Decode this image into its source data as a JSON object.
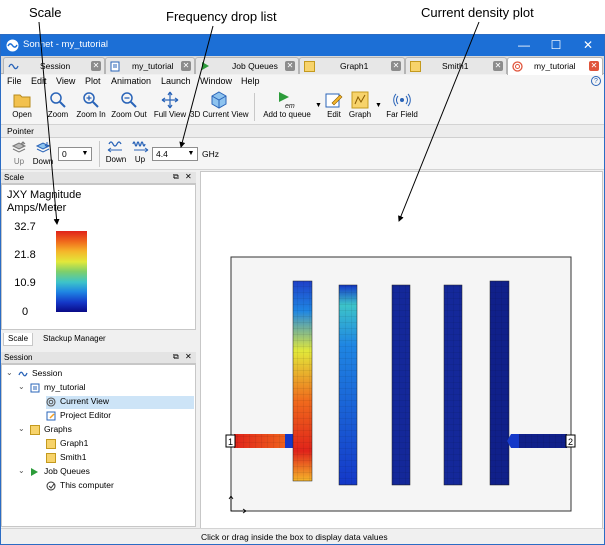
{
  "annotations": {
    "scale": "Scale",
    "frequency": "Frequency drop list",
    "current": "Current density plot"
  },
  "window": {
    "title": "Sonnet - my_tutorial",
    "minimize": "—",
    "maximize": "☐",
    "close": "✕"
  },
  "tabs": [
    {
      "label": "Session",
      "icon": "sonnet-wave-icon"
    },
    {
      "label": "my_tutorial",
      "icon": "project-icon"
    },
    {
      "label": "Job Queues",
      "icon": "em-icon"
    },
    {
      "label": "Graph1",
      "icon": "graph-icon"
    },
    {
      "label": "Smith1",
      "icon": "graph-icon"
    },
    {
      "label": "my_tutorial",
      "icon": "spiral-icon",
      "active": true
    }
  ],
  "menu": [
    "File",
    "Edit",
    "View",
    "Plot",
    "Animation",
    "Launch",
    "Window",
    "Help"
  ],
  "toolbar": {
    "open": "Open",
    "zoom": "Zoom",
    "zoom_in": "Zoom In",
    "zoom_out": "Zoom Out",
    "full_view": "Full View",
    "current_view_3d": "3D Current View",
    "add_to_queue": "Add to queue",
    "edit": "Edit",
    "graph": "Graph",
    "far_field": "Far Field"
  },
  "pointer": {
    "label": "Pointer"
  },
  "toolbar2": {
    "up": "Up",
    "down": "Down",
    "level_value": "0",
    "freq_down": "Down",
    "freq_up": "Up",
    "frequency_value": "4.4",
    "frequency_unit": "GHz"
  },
  "scale_panel": {
    "header": "Scale",
    "title_line1": "JXY Magnitude",
    "title_line2": "Amps/Meter",
    "values": [
      "32.7",
      "21.8",
      "10.9",
      "0"
    ],
    "colors": [
      "#e0231a",
      "#f06a1c",
      "#f5b52a",
      "#e2e83a",
      "#7fcf6a",
      "#3dc4c9",
      "#1f86e3",
      "#1438c8",
      "#0a0a86"
    ]
  },
  "subtabs": {
    "scale": "Scale",
    "stackup": "Stackup Manager"
  },
  "session_panel": {
    "header": "Session",
    "items": [
      {
        "label": "Session",
        "icon": "sonnet-wave-icon",
        "level": 0
      },
      {
        "label": "my_tutorial",
        "icon": "project-icon",
        "level": 1
      },
      {
        "label": "Current View",
        "icon": "spiral-icon",
        "level": 2,
        "selected": true
      },
      {
        "label": "Project Editor",
        "icon": "editor-icon",
        "level": 2
      },
      {
        "label": "Graphs",
        "icon": "graph-icon",
        "level": 1
      },
      {
        "label": "Graph1",
        "icon": "graph-icon",
        "level": 2
      },
      {
        "label": "Smith1",
        "icon": "graph-icon",
        "level": 2
      },
      {
        "label": "Job Queues",
        "icon": "em-icon",
        "level": 1
      },
      {
        "label": "This computer",
        "icon": "check-icon",
        "level": 2
      }
    ]
  },
  "plot": {
    "port1": "1",
    "port2": "2"
  },
  "status": "Click or drag inside the box to display data values",
  "accent": "#1c6fd6"
}
